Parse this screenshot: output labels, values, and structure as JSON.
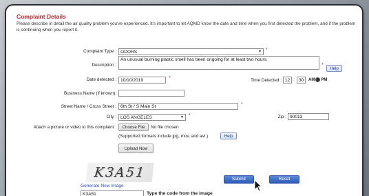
{
  "title": "Complaint Details",
  "description": "Please describe in detail the air quality problem you've experienced. It's important to let AQMD know the date and time when you first detected the problem, and if the problem is continuing when you report it.",
  "labels": {
    "complaint_type": "Complaint Type :",
    "description": "Description :",
    "date_detected": "Date detected :",
    "time_detected": "Time Detected :",
    "business_name": "Business Name (if known):",
    "street": "Street Name / Cross Street :",
    "city": "City :",
    "zip": "Zip :",
    "attach": "Attach a picture or video to this complaint :"
  },
  "values": {
    "complaint_type": "ODORS",
    "description": "An unusual burning plastic smell has been ongoing for at least two hours.",
    "date_detected": "10/10/2019",
    "time_hour": "12",
    "time_minute": "30",
    "business_name": "",
    "street": "6th St / S Main St",
    "city": "LOS ANGELES",
    "zip": "90013",
    "captcha_input": "K3A51"
  },
  "time_sep": ":",
  "ampm": {
    "am": "AM",
    "pm": "PM",
    "selected": "pm"
  },
  "required_marker": "*",
  "file": {
    "choose_label": "Choose File",
    "no_file": "No file chosen",
    "supported": "(Supported formats include jpg, mov, and avi.)",
    "upload_label": "Upload Now"
  },
  "help_label": "Help",
  "captcha": {
    "image_text": "K3A51",
    "generate_link": "Generate New Image",
    "instruction": "Type the code from the image"
  },
  "buttons": {
    "submit": "Submit",
    "reset": "Reset"
  },
  "colors": {
    "title": "#c0262d",
    "link": "#2b4fb3",
    "button_blue": "#2f5cb9"
  }
}
